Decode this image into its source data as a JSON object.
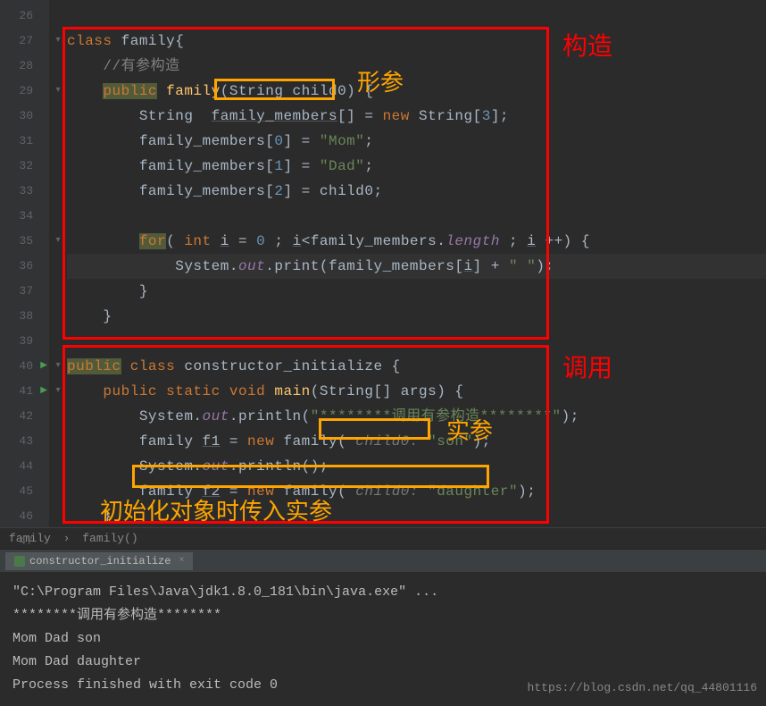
{
  "lineStart": 26,
  "currentLine": 36,
  "code": [
    {
      "t": [
        ""
      ]
    },
    {
      "t": [
        [
          "kw",
          "class"
        ],
        [
          "",
          " family{"
        ]
      ]
    },
    {
      "t": [
        [
          "",
          "    "
        ],
        [
          "comment",
          "//有参构造"
        ]
      ]
    },
    {
      "t": [
        [
          "",
          "    "
        ],
        [
          "hl-bg kw",
          "public"
        ],
        [
          "",
          " "
        ],
        [
          "method",
          "family"
        ],
        [
          "",
          "("
        ],
        [
          "cls",
          "String"
        ],
        [
          "",
          " child0"
        ],
        [
          "",
          ") {"
        ]
      ]
    },
    {
      "t": [
        [
          "",
          "        "
        ],
        [
          "cls",
          "String"
        ],
        [
          "",
          "  "
        ],
        [
          "ul",
          "family_members"
        ],
        [
          "",
          "[] = "
        ],
        [
          "kw",
          "new"
        ],
        [
          "",
          " "
        ],
        [
          "cls",
          "String"
        ],
        [
          "",
          "["
        ],
        [
          "num",
          "3"
        ],
        [
          "",
          "];"
        ]
      ]
    },
    {
      "t": [
        [
          "",
          "        family_members["
        ],
        [
          "num",
          "0"
        ],
        [
          "",
          "] = "
        ],
        [
          "str",
          "\"Mom\""
        ],
        [
          "",
          ";"
        ]
      ]
    },
    {
      "t": [
        [
          "",
          "        family_members["
        ],
        [
          "num",
          "1"
        ],
        [
          "",
          "] = "
        ],
        [
          "str",
          "\"Dad\""
        ],
        [
          "",
          ";"
        ]
      ]
    },
    {
      "t": [
        [
          "",
          "        family_members["
        ],
        [
          "num",
          "2"
        ],
        [
          "",
          "] = child0;"
        ]
      ]
    },
    {
      "t": [
        [
          "",
          ""
        ]
      ]
    },
    {
      "t": [
        [
          "",
          "        "
        ],
        [
          "hl-bg kw",
          "for"
        ],
        [
          "",
          "( "
        ],
        [
          "kw",
          "int"
        ],
        [
          "",
          " "
        ],
        [
          "ul",
          "i"
        ],
        [
          "",
          " = "
        ],
        [
          "num",
          "0"
        ],
        [
          "",
          " ; "
        ],
        [
          "ul",
          "i"
        ],
        [
          "",
          "<family_members."
        ],
        [
          "field",
          "length"
        ],
        [
          "",
          " ; "
        ],
        [
          "ul",
          "i"
        ],
        [
          "",
          " ++) {"
        ]
      ]
    },
    {
      "t": [
        [
          "",
          "            System."
        ],
        [
          "field",
          "out"
        ],
        [
          "",
          ".print(family_members["
        ],
        [
          "ul",
          "i"
        ],
        [
          "",
          "] + "
        ],
        [
          "str",
          "\" \""
        ],
        [
          "",
          ");"
        ]
      ]
    },
    {
      "t": [
        [
          "",
          "        }"
        ]
      ]
    },
    {
      "t": [
        [
          "",
          "    }"
        ]
      ]
    },
    {
      "t": [
        [
          ""
        ]
      ]
    },
    {
      "t": [
        [
          "hl-bg kw",
          "public"
        ],
        [
          "",
          " "
        ],
        [
          "kw",
          "class"
        ],
        [
          "",
          " constructor_initialize {"
        ]
      ]
    },
    {
      "t": [
        [
          "",
          "    "
        ],
        [
          "kw",
          "public"
        ],
        [
          "",
          " "
        ],
        [
          "kw",
          "static"
        ],
        [
          "",
          " "
        ],
        [
          "kw",
          "void"
        ],
        [
          "",
          " "
        ],
        [
          "method",
          "main"
        ],
        [
          "",
          "("
        ],
        [
          "cls",
          "String"
        ],
        [
          "",
          "[] args) {"
        ]
      ]
    },
    {
      "t": [
        [
          "",
          "        System."
        ],
        [
          "field",
          "out"
        ],
        [
          "",
          ".println("
        ],
        [
          "str",
          "\"********调用有参构造********\""
        ],
        [
          "",
          ");"
        ]
      ]
    },
    {
      "t": [
        [
          "",
          "        family "
        ],
        [
          "ul",
          "f1"
        ],
        [
          "",
          " = "
        ],
        [
          "kw",
          "new"
        ],
        [
          "",
          " family( "
        ],
        [
          "hint",
          "child0: "
        ],
        [
          "str",
          "\"son\""
        ],
        [
          "",
          ");"
        ]
      ]
    },
    {
      "t": [
        [
          "",
          "        System."
        ],
        [
          "field",
          "out"
        ],
        [
          "",
          ".println();"
        ]
      ]
    },
    {
      "t": [
        [
          "",
          "        family "
        ],
        [
          "ul",
          "f2"
        ],
        [
          "",
          " = "
        ],
        [
          "kw",
          "new"
        ],
        [
          "",
          " family( "
        ],
        [
          "hint",
          "child0: "
        ],
        [
          "str",
          "\"daughter\""
        ],
        [
          "",
          ");"
        ]
      ]
    },
    {
      "t": [
        [
          "",
          "    }"
        ]
      ]
    },
    {
      "t": [
        [
          ""
        ]
      ]
    }
  ],
  "playLines": [
    40,
    41
  ],
  "foldMarks": {
    "27": "▾",
    "29": "▾",
    "35": "▾",
    "40": "▾",
    "41": "▾"
  },
  "breadcrumb": [
    "family",
    "family()"
  ],
  "consoleTab": "constructor_initialize",
  "consoleOutput": [
    "\"C:\\Program Files\\Java\\jdk1.8.0_181\\bin\\java.exe\" ...",
    "********调用有参构造********",
    "Mom Dad son ",
    "Mom Dad daughter ",
    "Process finished with exit code 0"
  ],
  "annotations": {
    "red1": "构造",
    "red2": "调用",
    "orange1": "形参",
    "orange2": "实参",
    "orange3": "初始化对象时传入实参"
  },
  "watermark": "https://blog.csdn.net/qq_44801116"
}
